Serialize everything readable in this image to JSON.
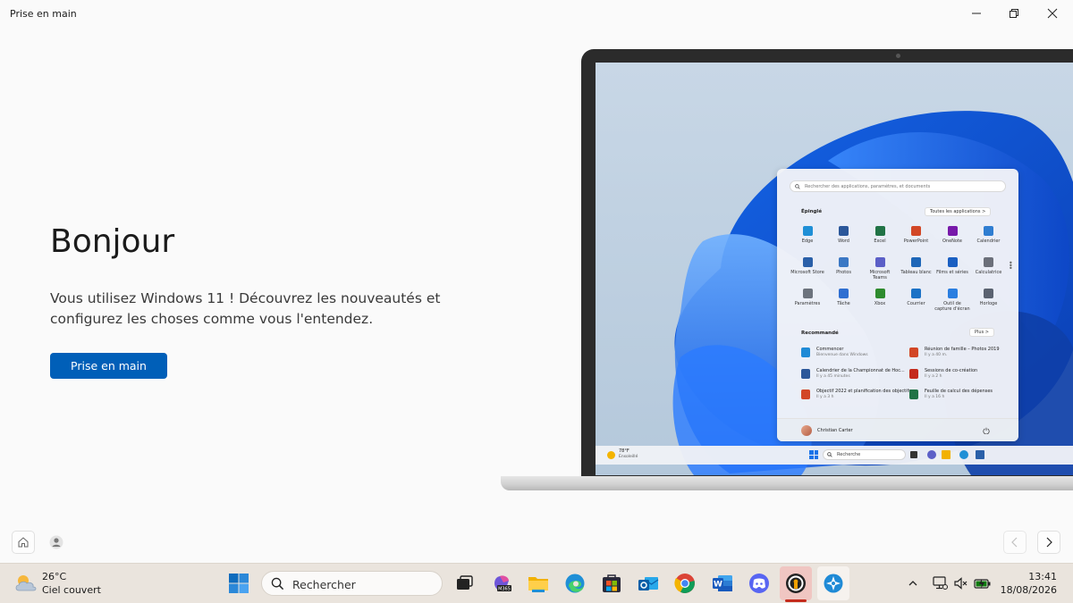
{
  "window": {
    "title": "Prise en main"
  },
  "main": {
    "heading": "Bonjour",
    "description": "Vous utilisez Windows 11 ! Découvrez les nouveautés et configurez les choses comme vous l'entendez.",
    "cta_label": "Prise en main"
  },
  "nav": {
    "home_icon": "home-icon",
    "person_icon": "person-icon",
    "prev_icon": "chevron-left-icon",
    "next_icon": "chevron-right-icon"
  },
  "preview": {
    "search_placeholder": "Rechercher des applications, paramètres, et documents",
    "pinned_heading": "Épinglé",
    "all_apps_label": "Toutes les applications  >",
    "pinned": [
      {
        "label": "Edge",
        "color": "#1f8fd6"
      },
      {
        "label": "Word",
        "color": "#2b579a"
      },
      {
        "label": "Excel",
        "color": "#217346"
      },
      {
        "label": "PowerPoint",
        "color": "#d24726"
      },
      {
        "label": "OneNote",
        "color": "#7719aa"
      },
      {
        "label": "Calendrier",
        "color": "#2f7dd1"
      },
      {
        "label": "Microsoft Store",
        "color": "#2a5fa8"
      },
      {
        "label": "Photos",
        "color": "#3b78c4"
      },
      {
        "label": "Microsoft Teams",
        "color": "#5b5fc7"
      },
      {
        "label": "Tableau blanc",
        "color": "#1d66b8"
      },
      {
        "label": "Films et séries",
        "color": "#1a5fc2"
      },
      {
        "label": "Calculatrice",
        "color": "#6b6f7a"
      },
      {
        "label": "Paramètres",
        "color": "#6c737d"
      },
      {
        "label": "Tâche",
        "color": "#2f6fd1"
      },
      {
        "label": "Xbox",
        "color": "#2e8b2e"
      },
      {
        "label": "Courrier",
        "color": "#1c72c6"
      },
      {
        "label": "Outil de capture d'écran",
        "color": "#2a7ee0"
      },
      {
        "label": "Horloge",
        "color": "#5a6270"
      }
    ],
    "recommended_heading": "Recommandé",
    "more_label": "Plus  >",
    "recommended": [
      {
        "title": "Commencer",
        "sub": "Bienvenue dans Windows",
        "color": "#1f8ad6"
      },
      {
        "title": "Réunion de famille – Photos 2019",
        "sub": "Il y a 40 m.",
        "color": "#d24726"
      },
      {
        "title": "Calendrier de la Championnat de Hoc...",
        "sub": "Il y a 45 minutes",
        "color": "#2b579a"
      },
      {
        "title": "Sessions de co-création",
        "sub": "Il y a 2 h",
        "color": "#c42b1c"
      },
      {
        "title": "Objectif 2022 et planification des objectifs",
        "sub": "Il y a 3 h",
        "color": "#d24726"
      },
      {
        "title": "Feuille de calcul des dépenses",
        "sub": "Il y a 16 h",
        "color": "#217346"
      }
    ],
    "user_name": "Christian Carter",
    "taskbar_temp": "78°F",
    "taskbar_weather": "Ensoleillé",
    "taskbar_search": "Recherche"
  },
  "taskbar": {
    "weather_temp": "26°C",
    "weather_desc": "Ciel couvert",
    "search_label": "Rechercher",
    "clock_time": "13:41",
    "clock_date": "18/08/2026",
    "accent": "#c42b1c"
  }
}
